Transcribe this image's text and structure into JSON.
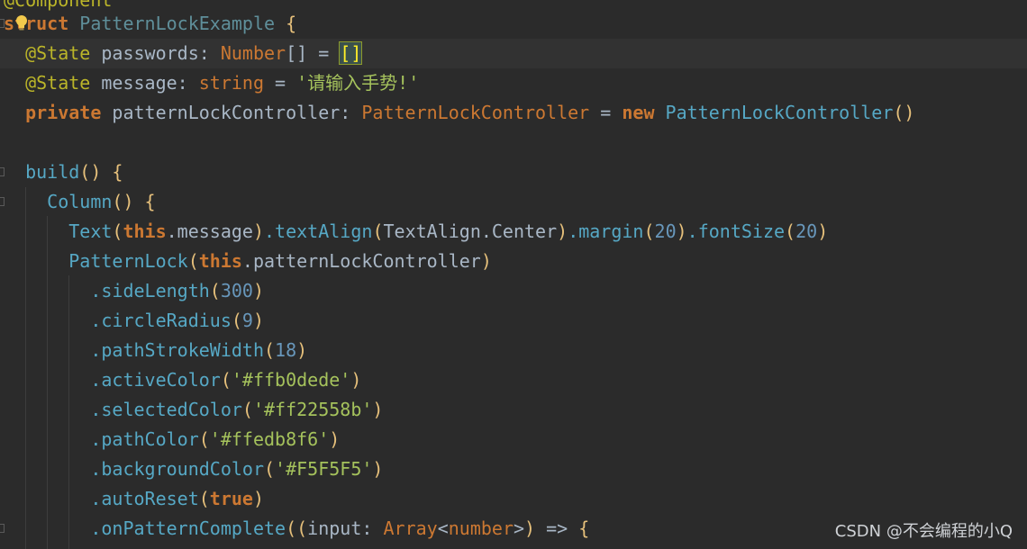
{
  "editor": {
    "partial_top_line": "@Component",
    "lines": [
      {
        "tokens": [
          {
            "t": "struct ",
            "c": "#cc7832",
            "b": true
          },
          {
            "t": "PatternLockExample",
            "c": "#5f8f9a"
          },
          {
            "t": " {",
            "c": "#e6c07b"
          }
        ]
      },
      {
        "current": true,
        "tokens": [
          {
            "t": "  @State",
            "c": "#bbb529"
          },
          {
            "t": " passwords: ",
            "c": "#a9b7c6"
          },
          {
            "t": "Number",
            "c": "#cc7832"
          },
          {
            "t": "[]",
            "c": "#a9b7c6"
          },
          {
            "t": " = ",
            "c": "#a9b7c6"
          },
          {
            "t": "[]",
            "c": "#ffef28",
            "hl": true
          }
        ]
      },
      {
        "tokens": [
          {
            "t": "  @State",
            "c": "#bbb529"
          },
          {
            "t": " message: ",
            "c": "#a9b7c6"
          },
          {
            "t": "string",
            "c": "#cc7832"
          },
          {
            "t": " = ",
            "c": "#a9b7c6"
          },
          {
            "t": "'请输入手势!'",
            "c": "#a5c25c"
          }
        ]
      },
      {
        "tokens": [
          {
            "t": "  private",
            "c": "#cc7832",
            "b": true
          },
          {
            "t": " patternLockController: ",
            "c": "#a9b7c6"
          },
          {
            "t": "PatternLockController",
            "c": "#cc7832"
          },
          {
            "t": " = ",
            "c": "#a9b7c6"
          },
          {
            "t": "new",
            "c": "#cc7832",
            "b": true
          },
          {
            "t": " PatternLockController",
            "c": "#56a8c5"
          },
          {
            "t": "()",
            "c": "#e6c07b"
          }
        ]
      },
      {
        "tokens": []
      },
      {
        "tokens": [
          {
            "t": "  build",
            "c": "#56a8c5"
          },
          {
            "t": "()",
            "c": "#e6c07b"
          },
          {
            "t": " {",
            "c": "#e6c07b"
          }
        ]
      },
      {
        "tokens": [
          {
            "t": "    Column",
            "c": "#56a8c5"
          },
          {
            "t": "()",
            "c": "#e6c07b"
          },
          {
            "t": " {",
            "c": "#e6c07b"
          }
        ]
      },
      {
        "tokens": [
          {
            "t": "      Text",
            "c": "#56a8c5"
          },
          {
            "t": "(",
            "c": "#e6c07b"
          },
          {
            "t": "this",
            "c": "#cc7832",
            "b": true
          },
          {
            "t": ".message",
            "c": "#a9b7c6"
          },
          {
            "t": ")",
            "c": "#e6c07b"
          },
          {
            "t": ".textAlign",
            "c": "#56a8c5"
          },
          {
            "t": "(",
            "c": "#e6c07b"
          },
          {
            "t": "TextAlign.Center",
            "c": "#a9b7c6"
          },
          {
            "t": ")",
            "c": "#e6c07b"
          },
          {
            "t": ".margin",
            "c": "#56a8c5"
          },
          {
            "t": "(",
            "c": "#e6c07b"
          },
          {
            "t": "20",
            "c": "#6897bb"
          },
          {
            "t": ")",
            "c": "#e6c07b"
          },
          {
            "t": ".fontSize",
            "c": "#56a8c5"
          },
          {
            "t": "(",
            "c": "#e6c07b"
          },
          {
            "t": "20",
            "c": "#6897bb"
          },
          {
            "t": ")",
            "c": "#e6c07b"
          }
        ]
      },
      {
        "tokens": [
          {
            "t": "      PatternLock",
            "c": "#56a8c5"
          },
          {
            "t": "(",
            "c": "#e6c07b"
          },
          {
            "t": "this",
            "c": "#cc7832",
            "b": true
          },
          {
            "t": ".patternLockController",
            "c": "#a9b7c6"
          },
          {
            "t": ")",
            "c": "#e6c07b"
          }
        ]
      },
      {
        "tokens": [
          {
            "t": "        .sideLength",
            "c": "#56a8c5"
          },
          {
            "t": "(",
            "c": "#e6c07b"
          },
          {
            "t": "300",
            "c": "#6897bb"
          },
          {
            "t": ")",
            "c": "#e6c07b"
          }
        ]
      },
      {
        "tokens": [
          {
            "t": "        .circleRadius",
            "c": "#56a8c5"
          },
          {
            "t": "(",
            "c": "#e6c07b"
          },
          {
            "t": "9",
            "c": "#6897bb"
          },
          {
            "t": ")",
            "c": "#e6c07b"
          }
        ]
      },
      {
        "tokens": [
          {
            "t": "        .pathStrokeWidth",
            "c": "#56a8c5"
          },
          {
            "t": "(",
            "c": "#e6c07b"
          },
          {
            "t": "18",
            "c": "#6897bb"
          },
          {
            "t": ")",
            "c": "#e6c07b"
          }
        ]
      },
      {
        "tokens": [
          {
            "t": "        .activeColor",
            "c": "#56a8c5"
          },
          {
            "t": "(",
            "c": "#e6c07b"
          },
          {
            "t": "'#ffb0dede'",
            "c": "#a5c25c"
          },
          {
            "t": ")",
            "c": "#e6c07b"
          }
        ]
      },
      {
        "tokens": [
          {
            "t": "        .selectedColor",
            "c": "#56a8c5"
          },
          {
            "t": "(",
            "c": "#e6c07b"
          },
          {
            "t": "'#ff22558b'",
            "c": "#a5c25c"
          },
          {
            "t": ")",
            "c": "#e6c07b"
          }
        ]
      },
      {
        "tokens": [
          {
            "t": "        .pathColor",
            "c": "#56a8c5"
          },
          {
            "t": "(",
            "c": "#e6c07b"
          },
          {
            "t": "'#ffedb8f6'",
            "c": "#a5c25c"
          },
          {
            "t": ")",
            "c": "#e6c07b"
          }
        ]
      },
      {
        "tokens": [
          {
            "t": "        .backgroundColor",
            "c": "#56a8c5"
          },
          {
            "t": "(",
            "c": "#e6c07b"
          },
          {
            "t": "'#F5F5F5'",
            "c": "#a5c25c"
          },
          {
            "t": ")",
            "c": "#e6c07b"
          }
        ]
      },
      {
        "tokens": [
          {
            "t": "        .autoReset",
            "c": "#56a8c5"
          },
          {
            "t": "(",
            "c": "#e6c07b"
          },
          {
            "t": "true",
            "c": "#cc7832",
            "b": true
          },
          {
            "t": ")",
            "c": "#e6c07b"
          }
        ]
      },
      {
        "tokens": [
          {
            "t": "        .onPatternComplete",
            "c": "#56a8c5"
          },
          {
            "t": "((",
            "c": "#e6c07b"
          },
          {
            "t": "input",
            "c": "#a9b7c6"
          },
          {
            "t": ": ",
            "c": "#a9b7c6"
          },
          {
            "t": "Array",
            "c": "#cc7832"
          },
          {
            "t": "<",
            "c": "#a9b7c6"
          },
          {
            "t": "number",
            "c": "#cc7832"
          },
          {
            "t": ">",
            "c": "#a9b7c6"
          },
          {
            "t": ")",
            "c": "#e6c07b"
          },
          {
            "t": " => ",
            "c": "#a9b7c6"
          },
          {
            "t": "{",
            "c": "#e6c07b"
          }
        ]
      }
    ]
  },
  "watermark": "CSDN @不会编程的小Q",
  "icons": {
    "intention": "lightbulb-icon",
    "fold": "fold-marker-icon"
  }
}
